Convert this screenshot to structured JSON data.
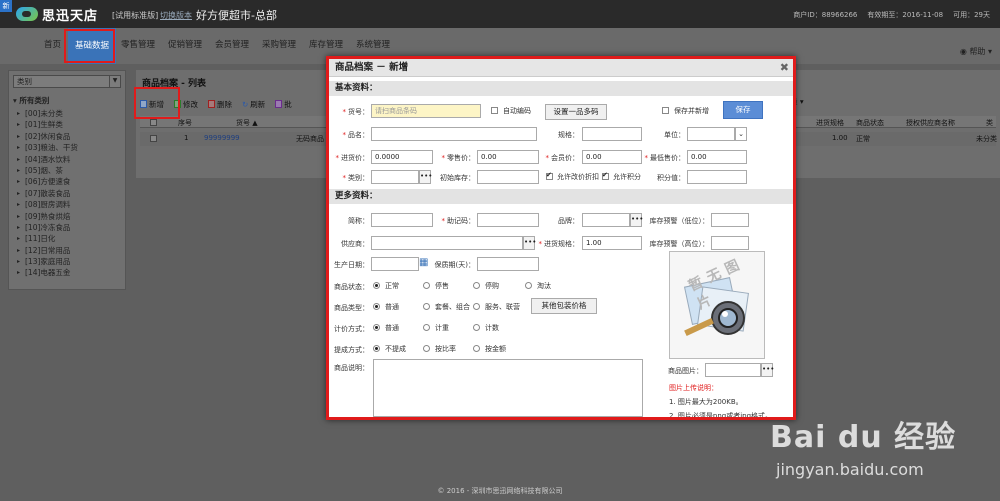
{
  "header": {
    "badge": "新",
    "logo_text": "思迅天店",
    "edition": "[试用标准版]",
    "switch_edition": "切换版本",
    "store_name": "好方便超市-总部",
    "account_info": [
      "商户ID：88966266",
      "有效期至：2016-11-08",
      "可用：29天"
    ]
  },
  "nav": {
    "items": [
      "首页",
      "基础数据",
      "零售管理",
      "促销管理",
      "会员管理",
      "采购管理",
      "库存管理",
      "系统管理"
    ],
    "active": "基础数据",
    "help": "帮助"
  },
  "sidebar": {
    "select_value": "类别",
    "root": "所有类别",
    "items": [
      "[00]未分类",
      "[01]生鲜类",
      "[02]休闲食品",
      "[03]粮油、干货",
      "[04]酒水饮料",
      "[05]烟、茶",
      "[06]方便速食",
      "[07]散装食品",
      "[08]厨房调料",
      "[09]熟食烘焙",
      "[10]冷冻食品",
      "[11]日化",
      "[12]日常用品",
      "[13]家庭用品",
      "[14]电器五金"
    ]
  },
  "list": {
    "title": "商品档案 - 列表",
    "toolbar": [
      "新增",
      "修改",
      "删除",
      "刷新",
      "批"
    ],
    "columns": [
      "序号",
      "货号 ▲",
      "进货规格",
      "商品状态",
      "授权供应商名称",
      "类"
    ],
    "row": {
      "index": "1",
      "code": "99999999",
      "name": "无码商品",
      "purchase_spec": "1.00",
      "status": "正常",
      "category": "未分类"
    },
    "bulk": "量"
  },
  "modal": {
    "title": "商品档案 － 新增",
    "basic_section": "基本资料：",
    "more_section": "更多资料：",
    "labels": {
      "code": "货号：",
      "name": "品名：",
      "spec": "规格：",
      "unit": "单位：",
      "purchase_price": "进货价：",
      "retail_price": "零售价：",
      "member_price": "会员价：",
      "min_price": "最低售价：",
      "category": "类别：",
      "init_stock": "初始库存：",
      "points": "积分值：",
      "short_name": "简称：",
      "mnemonic": "助记码：",
      "brand": "品牌：",
      "stock_low": "库存预警（低位）：",
      "supplier": "供应商：",
      "purchase_spec": "进货规格：",
      "stock_high": "库存预警（高位）：",
      "prod_date": "生产日期：",
      "shelf_life": "保质期(天)：",
      "status": "商品状态：",
      "type": "商品类型：",
      "pricing": "计价方式：",
      "commission": "提成方式：",
      "remark": "商品说明：",
      "image": "商品图片："
    },
    "values": {
      "code_placeholder": "请扫商品条码",
      "purchase_price": "0.0000",
      "retail_price": "0.00",
      "member_price": "0.00",
      "min_price": "0.00",
      "purchase_spec": "1.00"
    },
    "checks": {
      "auto_code": "自动编码",
      "save_and_new": "保存并新增",
      "allow_discount": "允许改价折扣",
      "allow_points": "允许积分"
    },
    "buttons": {
      "multi_barcode": "设置一品多码",
      "save": "保存",
      "package_price": "其他包装价格"
    },
    "radios": {
      "status": [
        "正常",
        "停售",
        "停购",
        "淘汰"
      ],
      "type": [
        "普通",
        "套餐、组合",
        "服务、联营"
      ],
      "pricing": [
        "普通",
        "计重",
        "计数"
      ],
      "commission": [
        "不提成",
        "按比率",
        "按金额"
      ]
    },
    "photo_placeholder": "暂无图片",
    "upload": {
      "title": "图片上传说明：",
      "notes": [
        "1. 图片最大为200KB。",
        "2. 图片必须是png或者jpg格式。"
      ]
    }
  },
  "footer": "© 2016 - 深圳市思迅网络科技有限公司",
  "watermark": {
    "logo": "Bai du 经验",
    "url": "jingyan.baidu.com"
  },
  "colors": {
    "accent": "#3a73b8",
    "highlight": "#e01b1b",
    "focus_input": "#fdf5c6"
  }
}
